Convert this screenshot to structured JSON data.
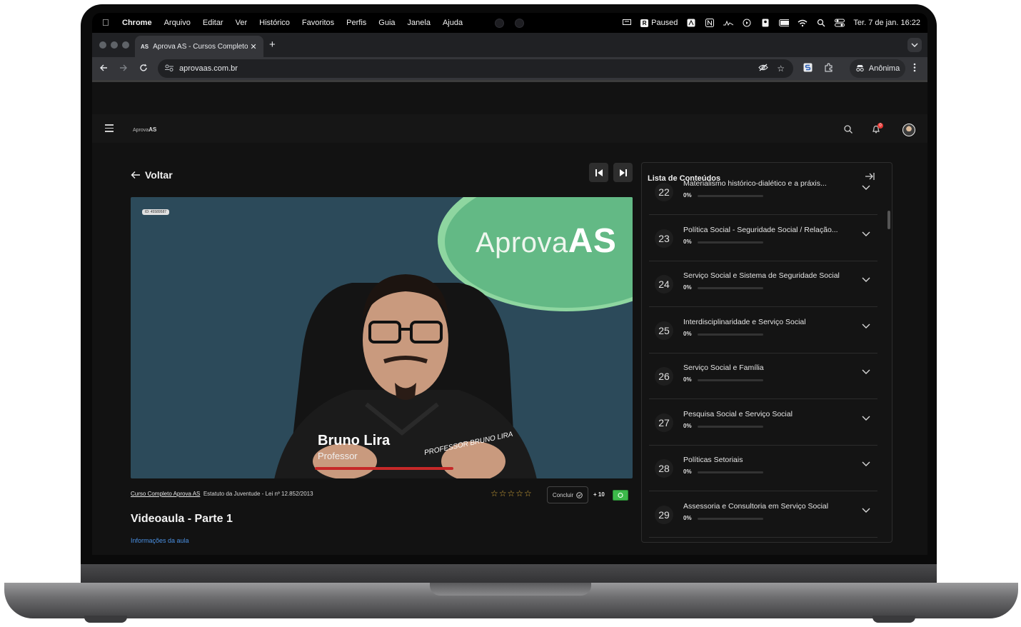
{
  "menubar": {
    "items": [
      "Chrome",
      "Arquivo",
      "Editar",
      "Ver",
      "Histórico",
      "Favoritos",
      "Perfis",
      "Guia",
      "Janela",
      "Ajuda"
    ],
    "paused_label": "Paused",
    "datetime": "Ter. 7 de jan.  16:22"
  },
  "browser": {
    "tab_title": "Aprova AS - Cursos Completo",
    "tab_favicon": "AS",
    "url": "aprovaas.com.br",
    "profile_label": "Anônima"
  },
  "app": {
    "logo_small": "Aprova",
    "logo_big": "AS",
    "notification_count": "0",
    "back_label": "Voltar"
  },
  "video": {
    "id_tag": "ID: 45589587",
    "brand_text": "Aprova",
    "brand_accent": "AS",
    "presenter_name": "Bruno Lira",
    "presenter_role": "Professor",
    "signature": "PROFESSOR BRUNO LIRA"
  },
  "lesson": {
    "course_link": "Curso Completo Aprova AS",
    "topic": "Estatuto da Juventude - Lei nº 12.852/2013",
    "rating_stars": "☆☆☆☆☆",
    "concluir_label": "Concluir",
    "points": "+ 10",
    "title": "Videoaula - Parte 1",
    "info_link": "Informações da aula"
  },
  "panel": {
    "title": "Lista de Conteúdos",
    "items": [
      {
        "num": "22",
        "title": "Materialismo histórico-dialético e a práxis...",
        "progress": "0%"
      },
      {
        "num": "23",
        "title": "Política Social - Seguridade Social / Relação...",
        "progress": "0%"
      },
      {
        "num": "24",
        "title": "Serviço Social e Sistema de Seguridade Social",
        "progress": "0%"
      },
      {
        "num": "25",
        "title": "Interdisciplinaridade e Serviço Social",
        "progress": "0%"
      },
      {
        "num": "26",
        "title": "Serviço Social e Família",
        "progress": "0%"
      },
      {
        "num": "27",
        "title": "Pesquisa Social e Serviço Social",
        "progress": "0%"
      },
      {
        "num": "28",
        "title": "Políticas Setoriais",
        "progress": "0%"
      },
      {
        "num": "29",
        "title": "Assessoria e Consultoria em Serviço Social",
        "progress": "0%"
      }
    ]
  },
  "colors": {
    "accent_blue": "#4a90e2",
    "brand_green": "#63b985",
    "star_gold": "#d4a73a",
    "badge_red": "#e53935"
  },
  "icons": [
    "apple-icon",
    "back-arrow-icon",
    "forward-arrow-icon",
    "reload-icon",
    "site-settings-icon",
    "eye-off-icon",
    "star-icon",
    "extension-icon",
    "incognito-icon",
    "kebab-icon",
    "menu-icon",
    "search-icon",
    "bell-icon",
    "prev-icon",
    "next-icon",
    "chevron-down-icon",
    "collapse-panel-icon"
  ]
}
